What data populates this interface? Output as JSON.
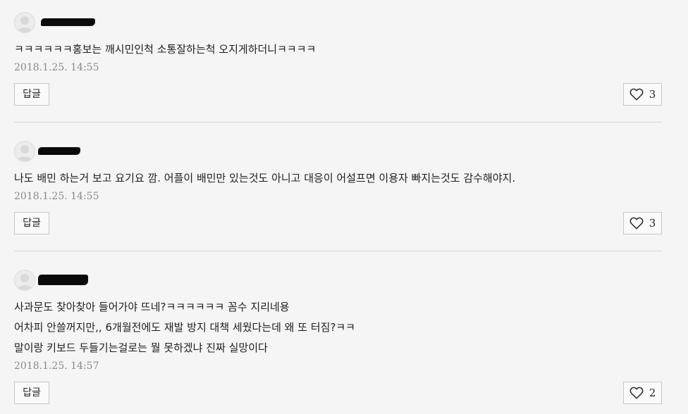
{
  "comments": [
    {
      "icons": {
        "avatar": "default-avatar-icon",
        "like": "heart-icon"
      },
      "lines": [
        "ㅋㅋㅋㅋㅋㅋ홍보는 깨시민인척 소통잘하는척 오지게하더니ㅋㅋㅋㅋ"
      ],
      "time": "2018.1.25. 14:55",
      "reply_label": "답글",
      "likes": "3"
    },
    {
      "icons": {
        "avatar": "default-avatar-icon",
        "like": "heart-icon"
      },
      "lines": [
        "나도 배민 하는거 보고 요기요 깜. 어플이 배민만 있는것도 아니고 대응이 어설프면 이용자 빠지는것도 감수해야지."
      ],
      "time": "2018.1.25. 14:55",
      "reply_label": "답글",
      "likes": "3"
    },
    {
      "icons": {
        "avatar": "default-avatar-icon",
        "like": "heart-icon"
      },
      "lines": [
        "사과문도 찾아찾아 들어가야 뜨네?ㅋㅋㅋㅋㅋㅋ 꼼수 지리네용",
        "어차피 안쓸꺼지만,, 6개월전에도 재발 방지 대책 세웠다는데 왜 또 터짐?ㅋㅋ",
        "말이랑 키보드 두들기는걸로는 뭘 못하겠냐 진짜 실망이다"
      ],
      "time": "2018.1.25. 14:57",
      "reply_label": "답글",
      "likes": "2"
    }
  ]
}
